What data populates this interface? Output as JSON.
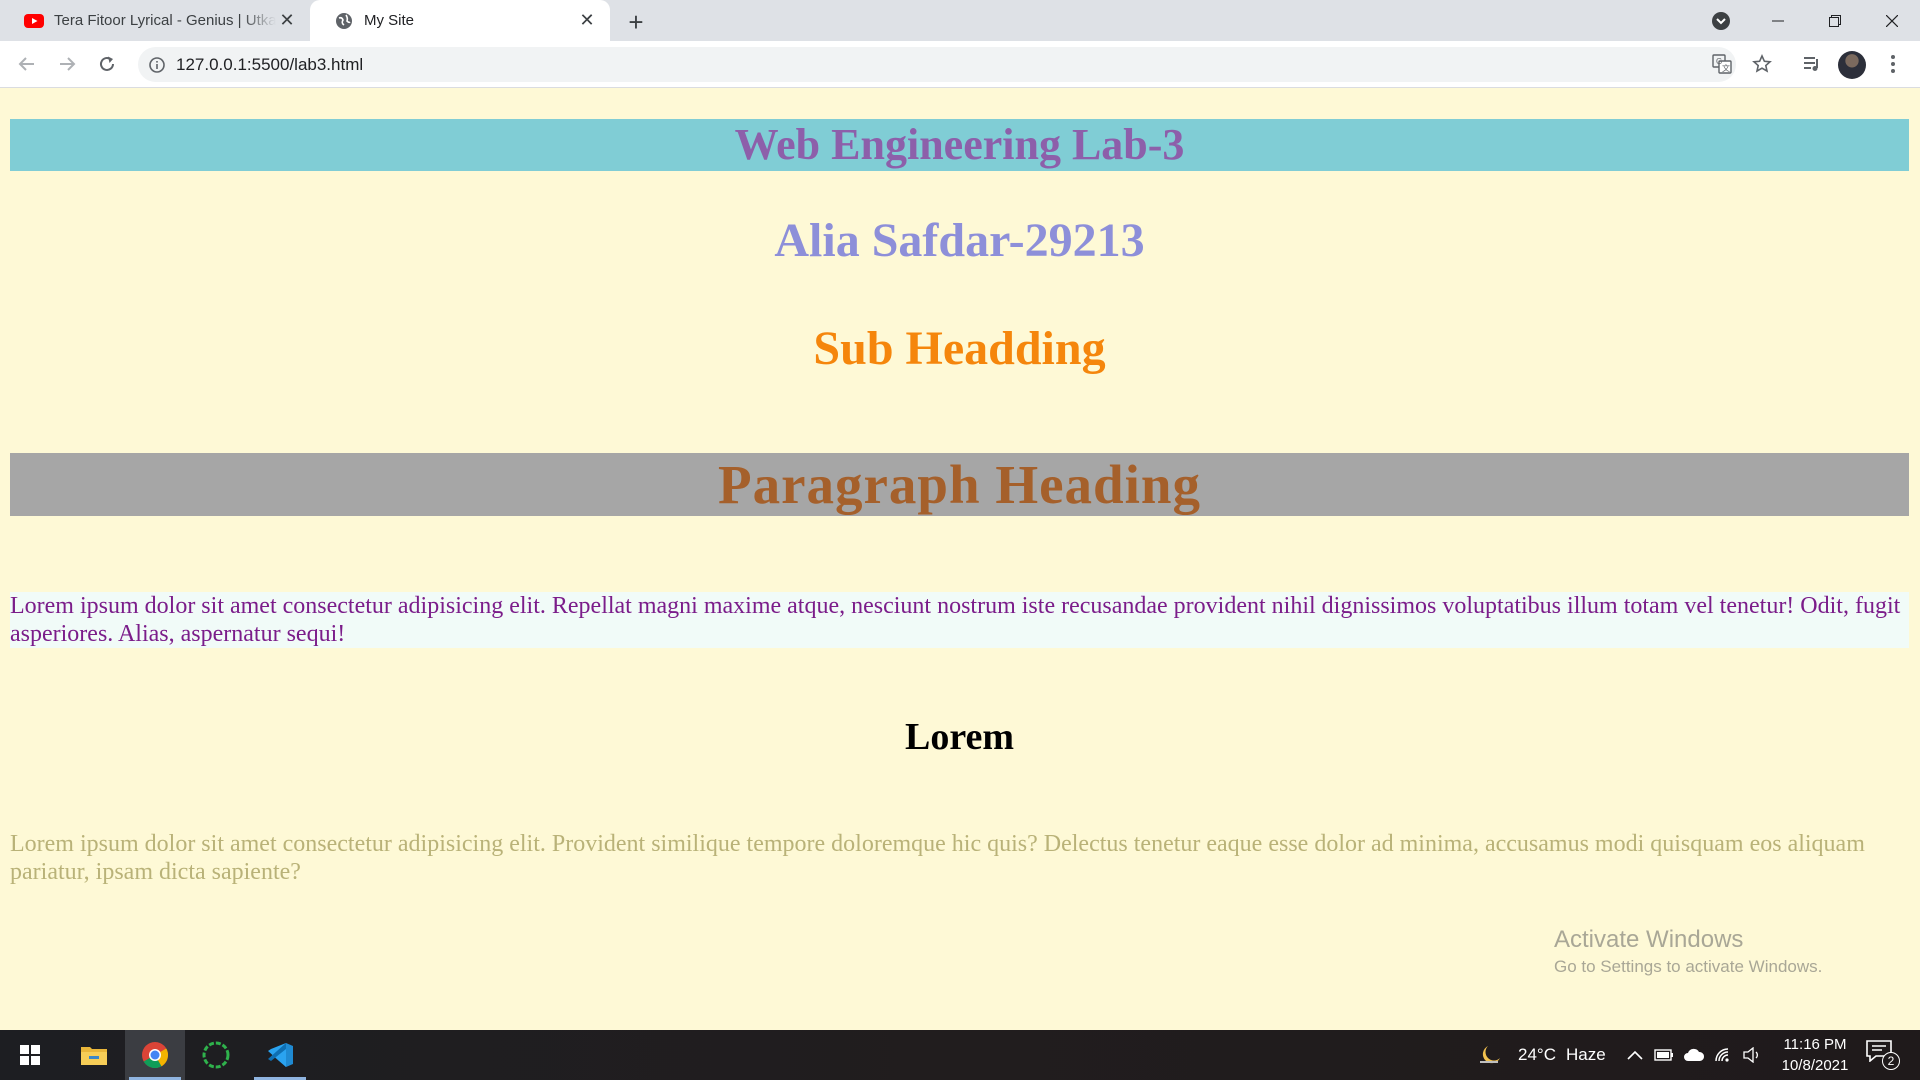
{
  "browser": {
    "tabs": [
      {
        "title": "Tera Fitoor Lyrical - Genius | Utka",
        "favicon": "youtube-icon",
        "active": false
      },
      {
        "title": "My Site",
        "favicon": "globe-icon",
        "active": true
      }
    ],
    "address": "127.0.0.1:5500/lab3.html"
  },
  "page": {
    "main_heading": "Web Engineering Lab-3",
    "name_heading": "Alia Safdar-29213",
    "sub_heading": "Sub Headding",
    "paragraph_heading": "Paragraph Heading",
    "paragraph_one": "Lorem ipsum dolor sit amet consectetur adipisicing elit. Repellat magni maxime atque, nesciunt nostrum iste recusandae provident nihil dignissimos voluptatibus illum totam vel tenetur! Odit, fugit asperiores. Alias, aspernatur sequi!",
    "lorem_heading": "Lorem",
    "paragraph_two": "Lorem ipsum dolor sit amet consectetur adipisicing elit. Provident similique tempore doloremque hic quis? Delectus tenetur eaque esse dolor ad minima, accusamus modi quisquam eos aliquam pariatur, ipsam dicta sapiente?",
    "colors": {
      "background": "#fef9d6",
      "main_heading_bg": "#80cdd5",
      "main_heading_text": "#8d5faa",
      "name_heading_text": "#8d8fd9",
      "sub_heading_text": "#f5860c",
      "paragraph_heading_bg": "#a6a6a6",
      "paragraph_heading_text": "#a5602b",
      "paragraph_one_bg": "#f1fbf8",
      "paragraph_one_text": "#7b1d8a",
      "paragraph_two_text": "#b9b278"
    }
  },
  "watermark": {
    "title": "Activate Windows",
    "subtitle": "Go to Settings to activate Windows."
  },
  "taskbar": {
    "apps": [
      "windows-start-icon",
      "file-explorer-icon",
      "chrome-icon",
      "loading-ring-icon",
      "vscode-icon"
    ],
    "weather": {
      "temp": "24°C",
      "condition": "Haze"
    },
    "time": "11:16 PM",
    "date": "10/8/2021",
    "notification_count": "2"
  }
}
